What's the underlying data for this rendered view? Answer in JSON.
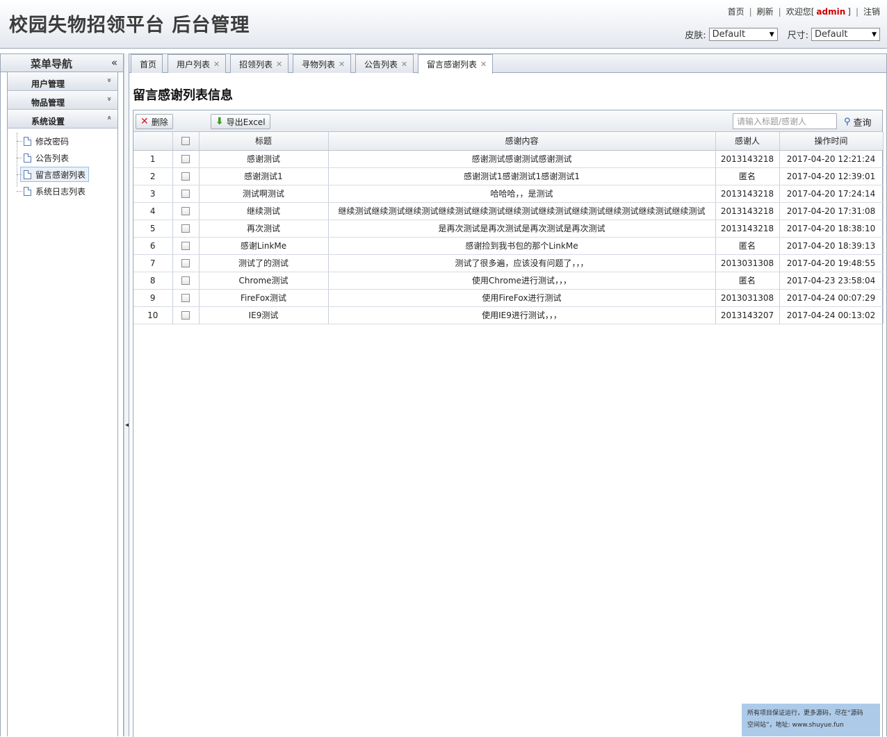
{
  "header": {
    "app_title": "校园失物招领平台 后台管理",
    "links": {
      "home": "首页",
      "refresh": "刷新",
      "welcome": "欢迎您[",
      "user": "admin",
      "welcome_end": "]",
      "logout": "注销"
    },
    "skin_label": "皮肤:",
    "skin_value": "Default",
    "size_label": "尺寸:",
    "size_value": "Default"
  },
  "sidebar": {
    "title": "菜单导航",
    "collapse": "«",
    "groups": [
      {
        "label": "用户管理",
        "chevron": "»"
      },
      {
        "label": "物品管理",
        "chevron": "»"
      },
      {
        "label": "系统设置",
        "chevron": "«"
      }
    ],
    "items": [
      {
        "label": "修改密码"
      },
      {
        "label": "公告列表"
      },
      {
        "label": "留言感谢列表"
      },
      {
        "label": "系统日志列表"
      }
    ]
  },
  "tabs": [
    {
      "label": "首页",
      "close": ""
    },
    {
      "label": "用户列表",
      "close": "✕"
    },
    {
      "label": "招领列表",
      "close": "✕"
    },
    {
      "label": "寻物列表",
      "close": "✕"
    },
    {
      "label": "公告列表",
      "close": "✕"
    },
    {
      "label": "留言感谢列表",
      "close": "✕"
    }
  ],
  "page_heading": "留言感谢列表信息",
  "toolbar": {
    "delete_label": "删除",
    "export_label": "导出Excel",
    "search_placeholder": "请输入标题/感谢人",
    "search_label": "查询"
  },
  "table": {
    "columns": [
      "",
      "",
      "标题",
      "感谢内容",
      "感谢人",
      "操作时间"
    ],
    "rows": [
      [
        "1",
        "感谢测试",
        "感谢测试感谢测试感谢测试",
        "2013143218",
        "2017-04-20 12:21:24"
      ],
      [
        "2",
        "感谢测试1",
        "感谢测试1感谢测试1感谢测试1",
        "匿名",
        "2017-04-20 12:39:01"
      ],
      [
        "3",
        "测试啊测试",
        "哈哈哈，，是测试",
        "2013143218",
        "2017-04-20 17:24:14"
      ],
      [
        "4",
        "继续测试",
        "继续测试继续测试继续测试继续测试继续测试继续测试继续测试继续测试继续测试继续测试继续测试",
        "2013143218",
        "2017-04-20 17:31:08"
      ],
      [
        "5",
        "再次测试",
        "是再次测试是再次测试是再次测试是再次测试",
        "2013143218",
        "2017-04-20 18:38:10"
      ],
      [
        "6",
        "感谢LinkMe",
        "感谢捡到我书包的那个LinkMe",
        "匿名",
        "2017-04-20 18:39:13"
      ],
      [
        "7",
        "测试了的测试",
        "测试了很多遍，应该没有问题了，，，",
        "2013031308",
        "2017-04-20 19:48:55"
      ],
      [
        "8",
        "Chrome测试",
        "使用Chrome进行测试，，，",
        "匿名",
        "2017-04-23 23:58:04"
      ],
      [
        "9",
        "FireFox测试",
        "使用FireFox进行测试",
        "2013031308",
        "2017-04-24 00:07:29"
      ],
      [
        "10",
        "IE9测试",
        "使用IE9进行测试，，，",
        "2013143207",
        "2017-04-24 00:13:02"
      ]
    ]
  },
  "watermark": {
    "line1": "所有项目保证运行，更多源码，尽在“源码",
    "line2": "空间站”，地址: www.shuyue.fun"
  }
}
